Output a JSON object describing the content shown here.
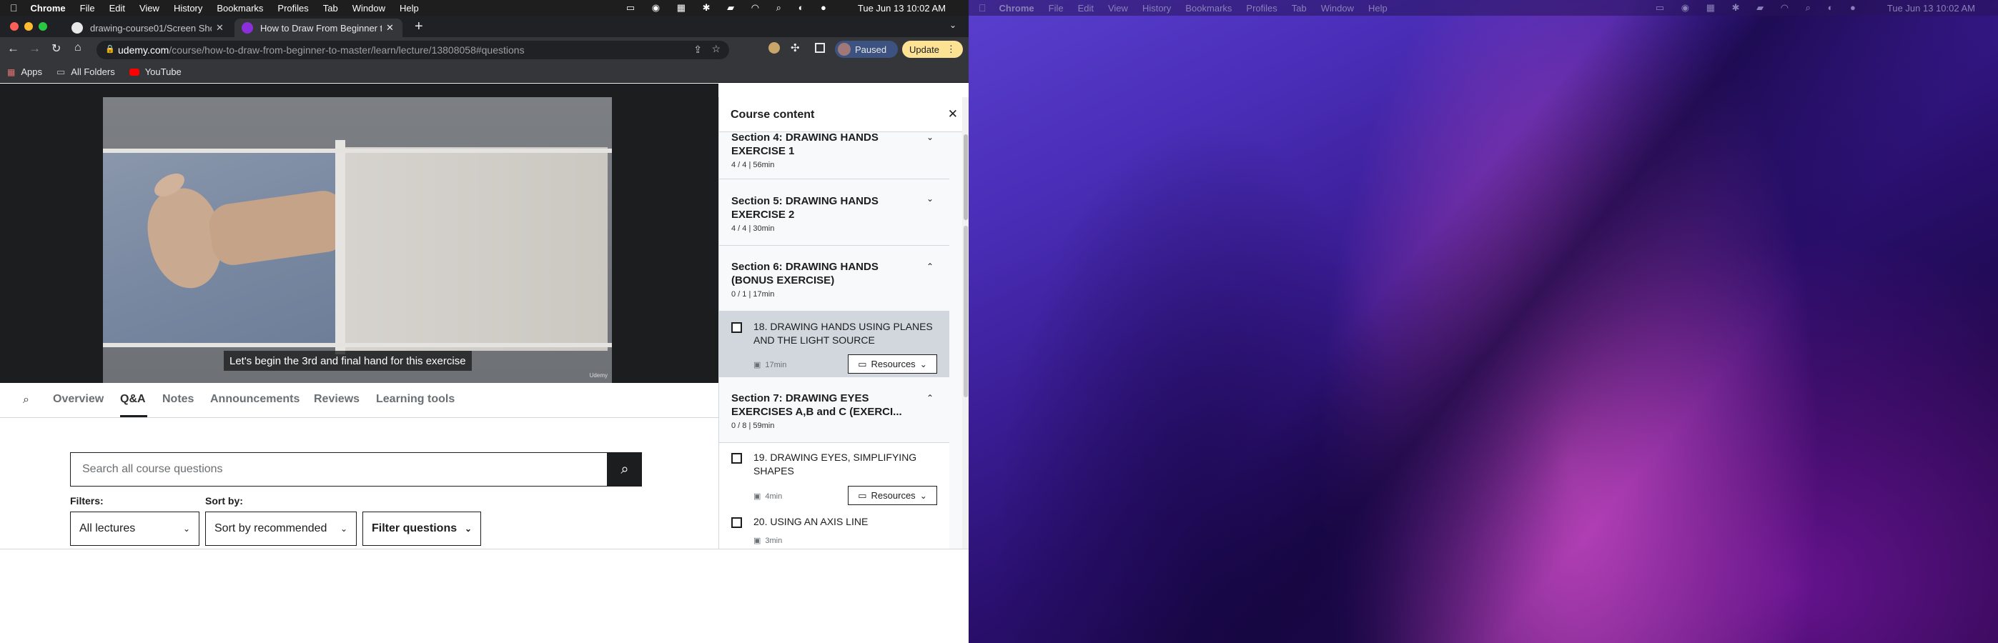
{
  "left_menubar": {
    "app": "Chrome",
    "items": [
      "File",
      "Edit",
      "View",
      "History",
      "Bookmarks",
      "Profiles",
      "Tab",
      "Window",
      "Help"
    ],
    "clock": "Tue Jun 13  10:02 AM"
  },
  "right_menubar": {
    "app": "Chrome",
    "items": [
      "File",
      "Edit",
      "View",
      "History",
      "Bookmarks",
      "Profiles",
      "Tab",
      "Window",
      "Help"
    ],
    "clock": "Tue Jun 13  10:02 AM"
  },
  "tabs": [
    {
      "label": "drawing-course01/Screen Sho"
    },
    {
      "label": "How to Draw From Beginner to"
    }
  ],
  "address": {
    "domain": "udemy.com",
    "path": "/course/how-to-draw-from-beginner-to-master/learn/lecture/13808058#questions"
  },
  "profile": {
    "paused": "Paused",
    "update": "Update"
  },
  "bookmarks": [
    "Apps",
    "All Folders",
    "YouTube"
  ],
  "video": {
    "caption": "Let's begin the 3rd and final hand for this exercise",
    "watermark": "Udemy"
  },
  "content_tabs": [
    "Overview",
    "Q&A",
    "Notes",
    "Announcements",
    "Reviews",
    "Learning tools"
  ],
  "qa": {
    "search_placeholder": "Search all course questions",
    "filters_label": "Filters:",
    "sort_label": "Sort by:",
    "lectures_select": "All lectures",
    "sort_select": "Sort by recommended",
    "filter_questions": "Filter questions"
  },
  "sidebar": {
    "title": "Course content",
    "sections": [
      {
        "title": "Section 4: DRAWING HANDS EXERCISE 1",
        "title_line2": "EXERCISE 1",
        "meta": "4 / 4 | 56min"
      },
      {
        "title_line1": "Section 5: DRAWING HANDS",
        "title_line2": "EXERCISE 2",
        "meta": "4 / 4 | 30min"
      },
      {
        "title_line1": "Section 6: DRAWING HANDS",
        "title_line2": "(BONUS EXERCISE)",
        "meta": "0 / 1 | 17min"
      },
      {
        "title_line1": "Section 7: DRAWING EYES",
        "title_line2": "EXERCISES A,B and C (EXERCI...",
        "meta": "0 / 8 | 59min"
      }
    ],
    "lectures": [
      {
        "line1": "18. DRAWING HANDS USING PLANES",
        "line2": "AND THE LIGHT SOURCE",
        "duration": "17min",
        "resources": "Resources"
      },
      {
        "line1": "19. DRAWING EYES, SIMPLIFYING",
        "line2": "SHAPES",
        "duration": "4min",
        "resources": "Resources"
      },
      {
        "line1": "20. USING AN AXIS LINE",
        "duration": "3min"
      }
    ],
    "section4_top": "Section 4: DRAWING HANDS"
  }
}
